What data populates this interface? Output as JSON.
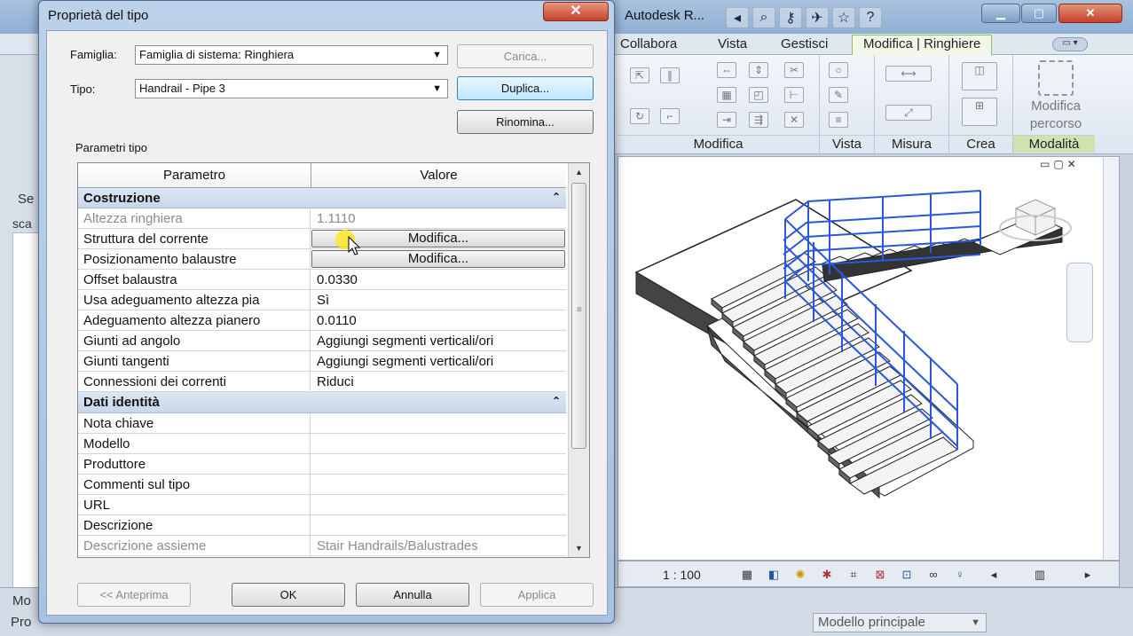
{
  "app": {
    "title": "Autodesk R...",
    "tabs": [
      "Collabora",
      "Vista",
      "Gestisci",
      "Modifica | Ringhiere"
    ],
    "panels": [
      "Modifica",
      "Vista",
      "Misura",
      "Crea",
      "Modalità"
    ],
    "modifica_percorso": "Modifica percorso",
    "left_labels": [
      "Se",
      "sca"
    ],
    "scale": "1 : 100",
    "status_left": [
      "Mo",
      "Pro"
    ],
    "workset": "Modello principale"
  },
  "dialog": {
    "title": "Proprietà del tipo",
    "famiglia_label": "Famiglia:",
    "famiglia_value": "Famiglia di sistema: Ringhiera",
    "tipo_label": "Tipo:",
    "tipo_value": "Handrail - Pipe 3",
    "carica_label": "Carica...",
    "duplica_label": "Duplica...",
    "rinomina_label": "Rinomina...",
    "params_label": "Parametri tipo",
    "col_param": "Parametro",
    "col_value": "Valore",
    "groups": [
      {
        "name": "Costruzione",
        "rows": [
          {
            "param": "Altezza ringhiera",
            "value": "1.1110"
          },
          {
            "param": "Struttura del corrente",
            "value": "Modifica..."
          },
          {
            "param": "Posizionamento balaustre",
            "value": "Modifica..."
          },
          {
            "param": "Offset balaustra",
            "value": "0.0330"
          },
          {
            "param": "Usa adeguamento altezza pia",
            "value": "Sì"
          },
          {
            "param": "Adeguamento altezza pianero",
            "value": "0.0110"
          },
          {
            "param": "Giunti ad angolo",
            "value": "Aggiungi segmenti verticali/ori"
          },
          {
            "param": "Giunti tangenti",
            "value": "Aggiungi segmenti verticali/ori"
          },
          {
            "param": "Connessioni dei correnti",
            "value": "Riduci"
          }
        ]
      },
      {
        "name": "Dati identità",
        "rows": [
          {
            "param": "Nota chiave",
            "value": ""
          },
          {
            "param": "Modello",
            "value": ""
          },
          {
            "param": "Produttore",
            "value": ""
          },
          {
            "param": "Commenti sul tipo",
            "value": ""
          },
          {
            "param": "URL",
            "value": ""
          },
          {
            "param": "Descrizione",
            "value": ""
          },
          {
            "param": "Descrizione assieme",
            "value": "Stair Handrails/Balustrades"
          }
        ]
      }
    ],
    "anteprima_label": "<< Anteprima",
    "ok_label": "OK",
    "annulla_label": "Annulla",
    "applica_label": "Applica",
    "close_glyph": "✕"
  },
  "colors": {
    "railing_blue": "#2b58d9",
    "dialog_frame": "#a7c1de",
    "group_header": "#c9d7ea"
  }
}
